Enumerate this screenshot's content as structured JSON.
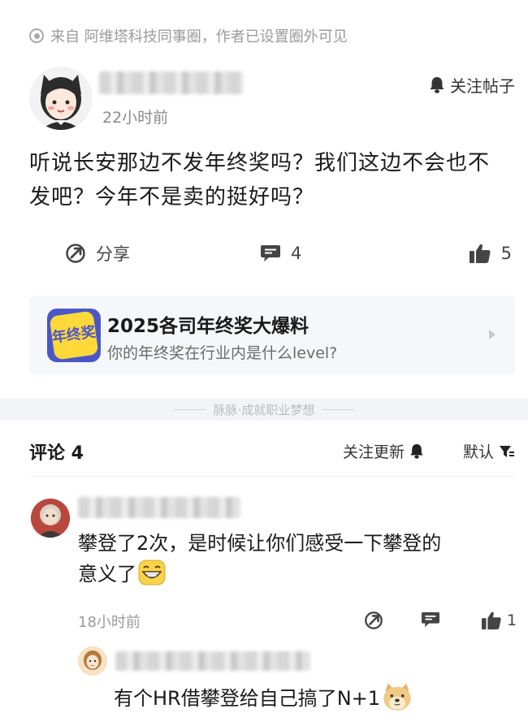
{
  "post": {
    "source_text": "来自 阿维塔科技同事圈，作者已设置圈外可见",
    "time": "22小时前",
    "follow_label": "关注帖子",
    "body_line1": "听说长安那边不发年终奖吗？我们这边不会也不",
    "body_line2": "发吧？今年不是卖的挺好吗？",
    "share_label": "分享",
    "comment_count": "4",
    "like_count": "5"
  },
  "topic": {
    "icon_text": "年终奖",
    "title": "2025各司年终奖大爆料",
    "subtitle": "你的年终奖在行业内是什么level?"
  },
  "divider": {
    "text": "脉脉·成就职业梦想"
  },
  "comments": {
    "title": "评论 4",
    "follow_update_label": "关注更新",
    "sort_label": "默认",
    "first": {
      "body_line1": "攀登了2次，是时候让你们感受一下攀登的",
      "body_line2": "意义了",
      "time": "18小时前",
      "like_count": "1"
    },
    "reply": {
      "body": "有个HR借攀登给自己搞了N+1"
    }
  },
  "icons": {
    "source": "circle-dot-icon",
    "bell": "bell-icon",
    "share": "share-icon",
    "comment": "comment-icon",
    "like": "thumbs-up-icon",
    "sort": "filter-icon",
    "emoji_laugh": "grin-emoji-icon",
    "emoji_dog": "doge-emoji-icon"
  }
}
